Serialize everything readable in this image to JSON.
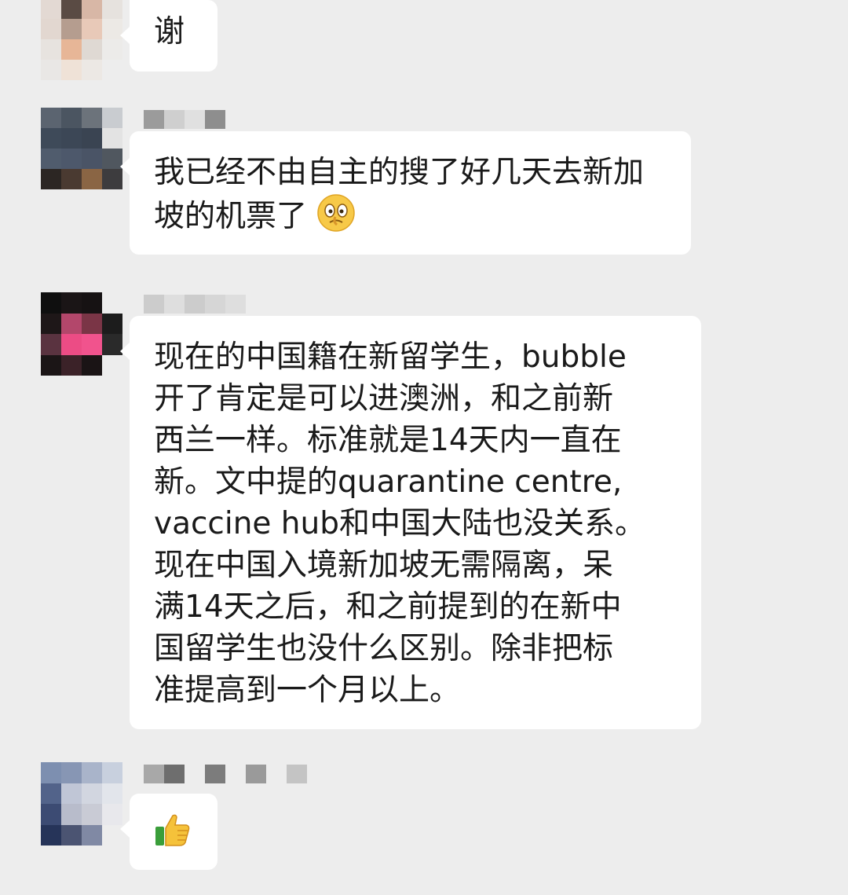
{
  "messages": [
    {
      "id": "m1",
      "text": "谢",
      "emoji": null
    },
    {
      "id": "m2",
      "text": "我已经不由自主的搜了好几天去新加坡的机票了",
      "emoji": "thinking-face"
    },
    {
      "id": "m3",
      "text": "现在的中国籍在新留学生，bubble开了肯定是可以进澳洲，和之前新西兰一样。标准就是14天内一直在新。文中提的quarantine centre, vaccine hub和中国大陆也没关系。现在中国入境新加坡无需隔离，呆满14天之后，和之前提到的在新中国留学生也没什么区别。除非把标准提高到一个月以上。",
      "lines": [
        "现在的中国籍在新留学生，bubble",
        "开了肯定是可以进澳洲，和之前新",
        "西兰一样。标准就是14天内一直在",
        "新。文中提的quarantine centre,",
        "vaccine hub和中国大陆也没关系。",
        "现在中国入境新加坡无需隔离，呆",
        "满14天之后，和之前提到的在新中",
        "国留学生也没什么区别。除非把标",
        "准提高到一个月以上。"
      ]
    },
    {
      "id": "m4",
      "text": "",
      "emoji": "thumbs-up"
    }
  ],
  "colors": {
    "background": "#ededed",
    "bubble": "#ffffff",
    "text": "#1a1a1a"
  }
}
